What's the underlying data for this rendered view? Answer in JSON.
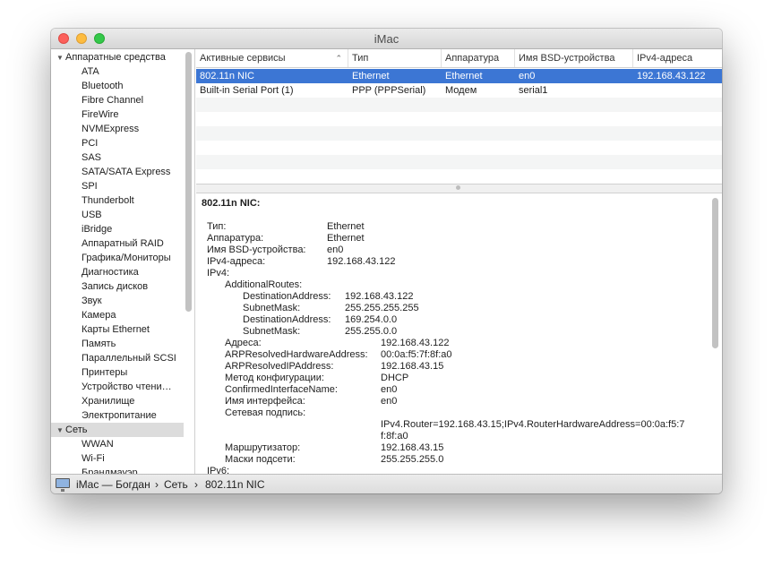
{
  "window": {
    "title": "iMac"
  },
  "sidebar": {
    "hardware_group": "Аппаратные средства",
    "hardware_items": [
      "ATA",
      "Bluetooth",
      "Fibre Channel",
      "FireWire",
      "NVMExpress",
      "PCI",
      "SAS",
      "SATA/SATA Express",
      "SPI",
      "Thunderbolt",
      "USB",
      "iBridge",
      "Аппаратный RAID",
      "Графика/Мониторы",
      "Диагностика",
      "Запись дисков",
      "Звук",
      "Камера",
      "Карты Ethernet",
      "Память",
      "Параллельный SCSI",
      "Принтеры",
      "Устройство чтени…",
      "Хранилище",
      "Электропитание"
    ],
    "network_group": "Сеть",
    "network_items": [
      "WWAN",
      "Wi-Fi",
      "Брандмауэр"
    ]
  },
  "table": {
    "headers": [
      "Активные сервисы",
      "Тип",
      "Аппаратура",
      "Имя BSD-устройства",
      "IPv4-адреса"
    ],
    "rows": [
      [
        "802.11n NIC",
        "Ethernet",
        "Ethernet",
        "en0",
        "192.168.43.122"
      ],
      [
        "Built-in Serial Port (1)",
        "PPP (PPPSerial)",
        "Модем",
        "serial1",
        ""
      ]
    ]
  },
  "detail": {
    "title": "802.11n NIC:",
    "type_label": "Тип:",
    "type_value": "Ethernet",
    "hw_label": "Аппаратура:",
    "hw_value": "Ethernet",
    "bsd_label": "Имя BSD-устройства:",
    "bsd_value": "en0",
    "ipv4addr_label": "IPv4-адреса:",
    "ipv4addr_value": "192.168.43.122",
    "ipv4_label": "IPv4:",
    "routes_label": "AdditionalRoutes:",
    "r1_dest_label": "DestinationAddress:",
    "r1_dest_value": "192.168.43.122",
    "r1_mask_label": "SubnetMask:",
    "r1_mask_value": "255.255.255.255",
    "r2_dest_label": "DestinationAddress:",
    "r2_dest_value": "169.254.0.0",
    "r2_mask_label": "SubnetMask:",
    "r2_mask_value": "255.255.0.0",
    "addr_label": "Адреса:",
    "addr_value": "192.168.43.122",
    "arphw_label": "ARPResolvedHardwareAddress:",
    "arphw_value": "00:0a:f5:7f:8f:a0",
    "arpip_label": "ARPResolvedIPAddress:",
    "arpip_value": "192.168.43.15",
    "cfg_label": "Метод конфигурации:",
    "cfg_value": "DHCP",
    "cif_label": "ConfirmedInterfaceName:",
    "cif_value": "en0",
    "ifname_label": "Имя интерфейса:",
    "ifname_value": "en0",
    "netsig_label": "Сетевая подпись:",
    "netsig_line1": "IPv4.Router=192.168.43.15;IPv4.RouterHardwareAddress=00:0a:f5:7",
    "netsig_line2": "f:8f:a0",
    "router_label": "Маршрутизатор:",
    "router_value": "192.168.43.15",
    "masks_label": "Маски подсети:",
    "masks_value": "255.255.255.0",
    "ipv6_label": "IPv6:"
  },
  "statusbar": {
    "computer": "iMac — Богдан",
    "section": "Сеть",
    "item": "802.11n NIC",
    "separator": "›"
  }
}
